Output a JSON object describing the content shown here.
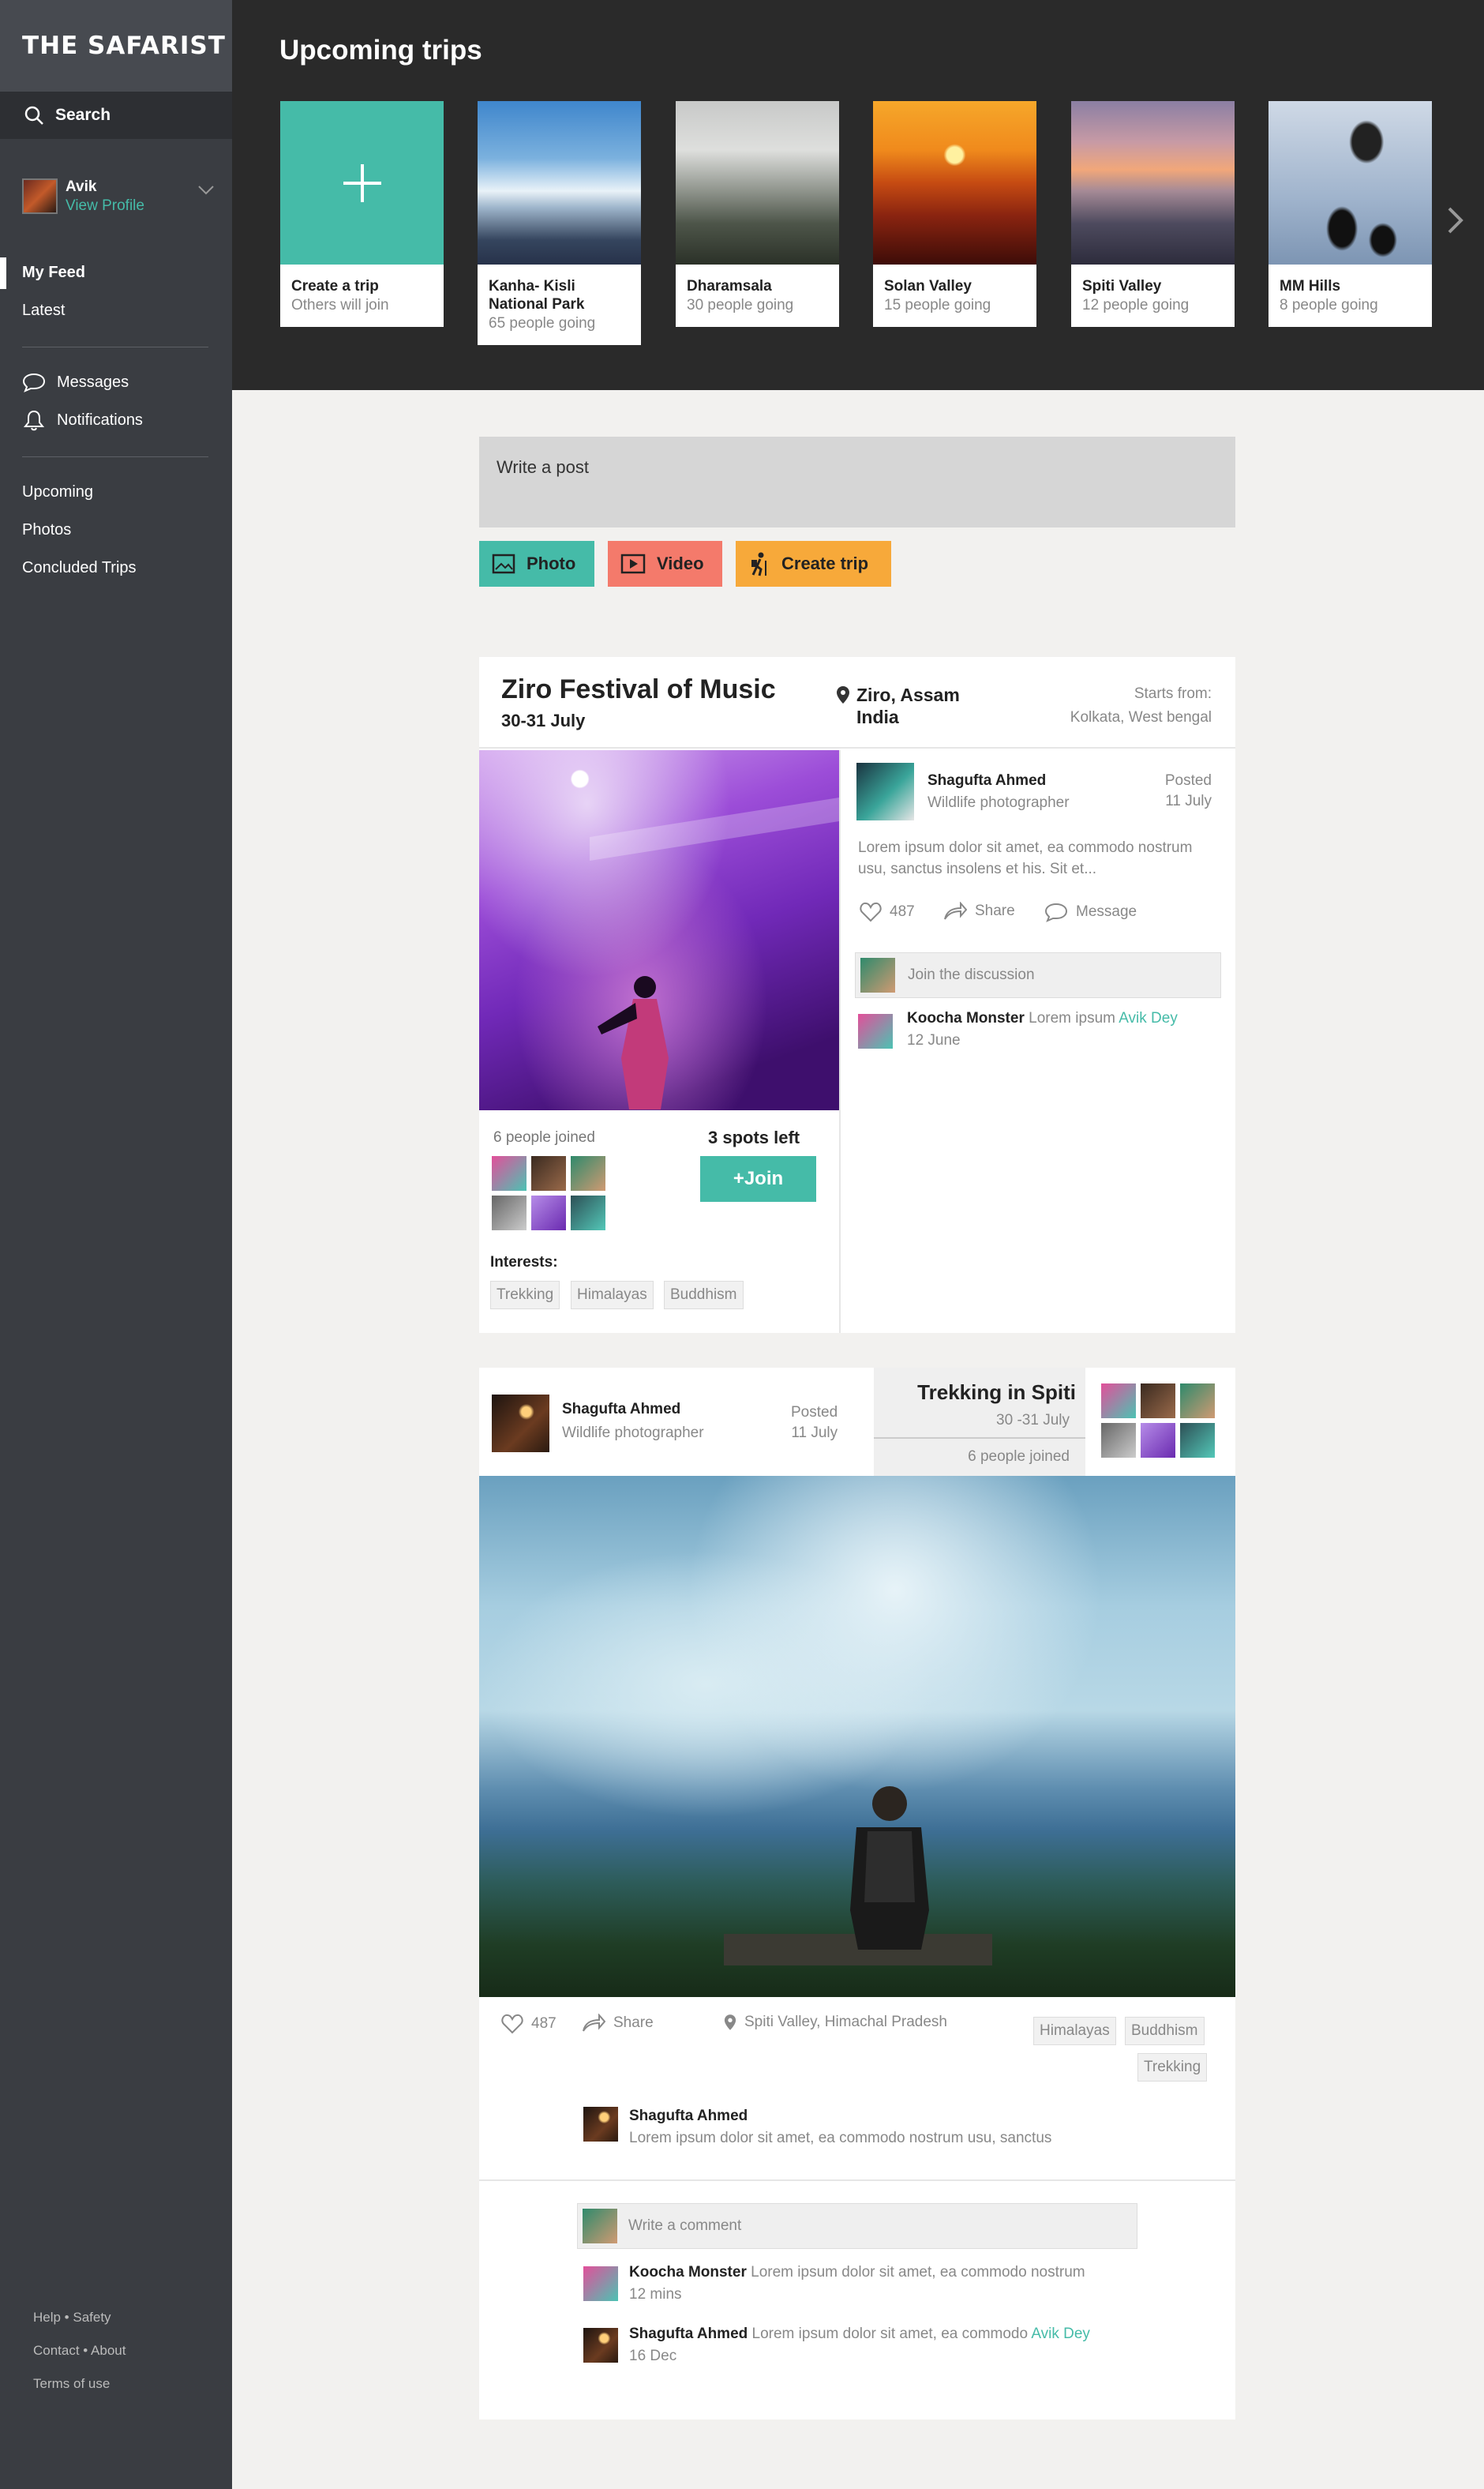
{
  "brand": "THE SAFARIST",
  "search_label": "Search",
  "profile": {
    "name": "Avik",
    "link": "View Profile"
  },
  "nav_primary": [
    "My Feed",
    "Latest"
  ],
  "nav_social": [
    "Messages",
    "Notifications"
  ],
  "nav_trips": [
    "Upcoming",
    "Photos",
    "Concluded Trips"
  ],
  "footer": [
    "Help • Safety",
    "Contact • About",
    "Terms of use"
  ],
  "upcoming": {
    "title": "Upcoming trips",
    "trips": [
      {
        "name": "Create a trip",
        "sub": "Others will join"
      },
      {
        "name": "Kanha- Kisli National Park",
        "sub": "65 people going"
      },
      {
        "name": "Dharamsala",
        "sub": "30 people going"
      },
      {
        "name": "Solan Valley",
        "sub": "15 people going"
      },
      {
        "name": "Spiti Valley",
        "sub": "12 people going"
      },
      {
        "name": "MM Hills",
        "sub": "8 people going"
      }
    ]
  },
  "composer": {
    "placeholder": "Write a post",
    "photo": "Photo",
    "video": "Video",
    "create_trip": "Create trip"
  },
  "colors": {
    "accent": "#45bba8",
    "video": "#f47a6b",
    "trip": "#f7a93a"
  },
  "card1": {
    "title": "Ziro Festival of Music",
    "date": "30-31 July",
    "loc1": "Ziro, Assam",
    "loc2": "India",
    "starts_label": "Starts from:",
    "starts_place": "Kolkata, West bengal",
    "joined": "6 people joined",
    "spots": "3 spots left",
    "join": "+Join",
    "interests_label": "Interests:",
    "tags": [
      "Trekking",
      "Himalayas",
      "Buddhism"
    ],
    "post": {
      "name": "Shagufta Ahmed",
      "role": "Wildlife photographer",
      "posted": "Posted",
      "posted_date": "11 July",
      "body": "Lorem ipsum dolor sit amet, ea commodo nostrum usu, sanctus insolens et his. Sit et...",
      "likes": "487",
      "share": "Share",
      "message": "Message",
      "discuss": "Join the discussion",
      "comment_name": "Koocha Monster",
      "comment_text": "Lorem ipsum",
      "comment_link": "Avik Dey",
      "comment_date": "12 June"
    }
  },
  "card2": {
    "name": "Shagufta Ahmed",
    "role": "Wildlife photographer",
    "posted": "Posted",
    "posted_date": "11 July",
    "trip_title": "Trekking in Spiti",
    "trip_date": "30 -31 July",
    "trip_joined": "6 people joined",
    "likes": "487",
    "share": "Share",
    "location": "Spiti Valley, Himachal Pradesh",
    "tags": [
      "Himalayas",
      "Buddhism",
      "Trekking"
    ],
    "caption_name": "Shagufta Ahmed",
    "caption_text": "Lorem ipsum dolor sit amet, ea commodo nostrum usu, sanctus",
    "comment_placeholder": "Write a comment",
    "comments": [
      {
        "name": "Koocha Monster",
        "text": "Lorem ipsum dolor sit amet, ea commodo nostrum",
        "link": "",
        "date": "12 mins"
      },
      {
        "name": "Shagufta Ahmed",
        "text": "Lorem ipsum dolor sit amet, ea commodo",
        "link": "Avik Dey",
        "date": "16 Dec"
      }
    ]
  }
}
